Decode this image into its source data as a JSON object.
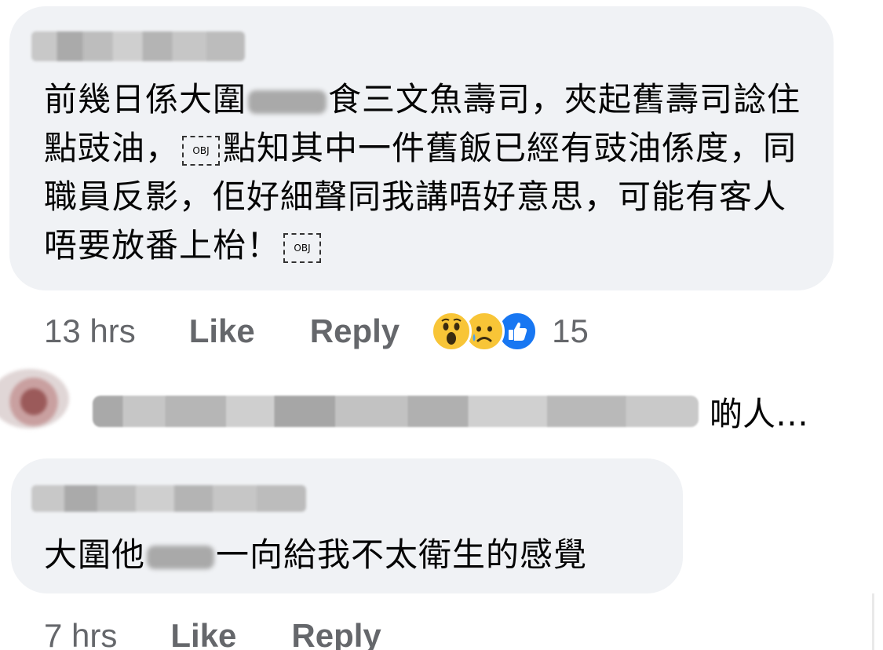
{
  "comments": [
    {
      "text_segments": [
        "前幾日係大圍",
        "食三文魚壽司，夾起舊壽司諗住點豉油，",
        "點知其中一件舊飯已經有豉油係度，同職員反影，佢好細聲同我講唔好意思，可能有客人唔要放番上枱！"
      ],
      "obj_label": "OBJ",
      "meta": {
        "time": "13 hrs",
        "like_label": "Like",
        "reply_label": "Reply",
        "reaction_count": "15",
        "reactions": [
          "wow-icon",
          "sad-icon",
          "like-icon"
        ]
      }
    },
    {
      "text_segments": [
        "大圍他",
        "一向給我不太衛生的感覺"
      ],
      "meta": {
        "time": "7 hrs",
        "like_label": "Like",
        "reply_label": "Reply"
      }
    }
  ],
  "reply_preview": {
    "trailing_text": "啲人…"
  },
  "colors": {
    "bubble": "#f0f2f5",
    "meta_text": "#65676b",
    "text": "#050505",
    "like_blue": "#1877f2",
    "emoji_yellow": "#f8c537"
  }
}
